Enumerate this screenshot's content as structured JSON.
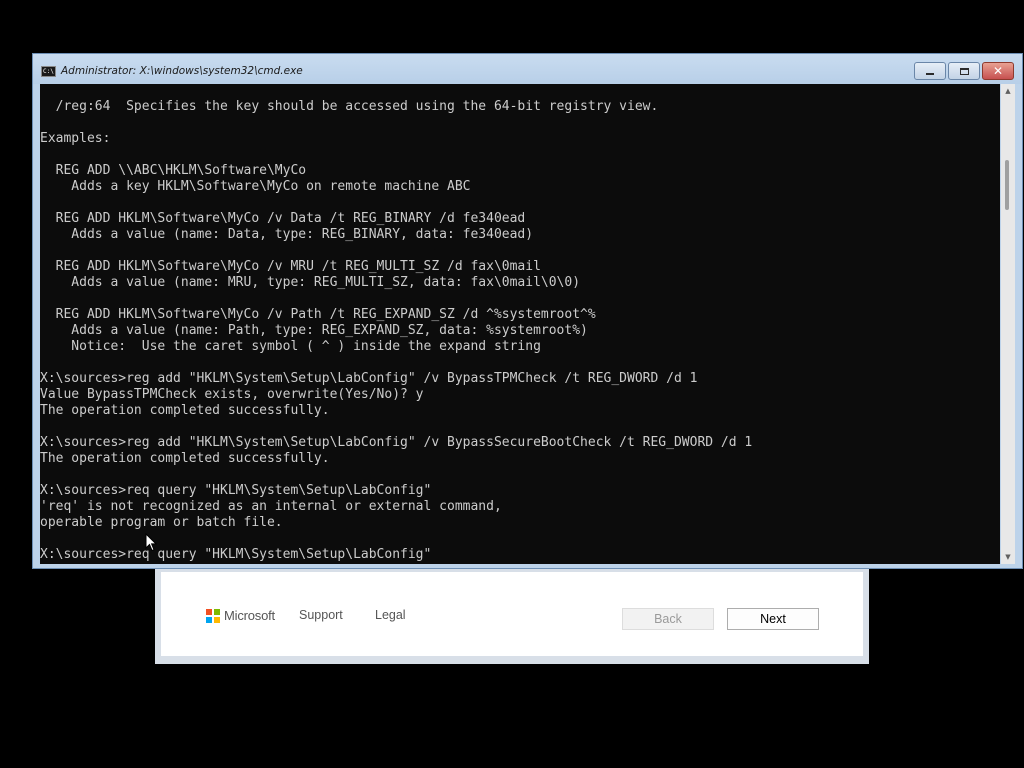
{
  "setup_window": {
    "logo_text": "Microsoft",
    "logo_colors": [
      "#f25022",
      "#7fba00",
      "#00a4ef",
      "#ffb900"
    ],
    "support_label": "Support",
    "legal_label": "Legal",
    "back_label": "Back",
    "next_label": "Next",
    "back_enabled": false
  },
  "cmd_window": {
    "title": "Administrator: X:\\windows\\system32\\cmd.exe",
    "icon": "cmd-icon",
    "icon_text": "C:\\",
    "min_icon": "minimize-icon",
    "max_icon": "maximize-icon",
    "close_icon": "close-icon",
    "close_glyph": "✕",
    "console_lines": [
      "  /reg:64  Specifies the key should be accessed using the 64-bit registry view.",
      "",
      "Examples:",
      "",
      "  REG ADD \\\\ABC\\HKLM\\Software\\MyCo",
      "    Adds a key HKLM\\Software\\MyCo on remote machine ABC",
      "",
      "  REG ADD HKLM\\Software\\MyCo /v Data /t REG_BINARY /d fe340ead",
      "    Adds a value (name: Data, type: REG_BINARY, data: fe340ead)",
      "",
      "  REG ADD HKLM\\Software\\MyCo /v MRU /t REG_MULTI_SZ /d fax\\0mail",
      "    Adds a value (name: MRU, type: REG_MULTI_SZ, data: fax\\0mail\\0\\0)",
      "",
      "  REG ADD HKLM\\Software\\MyCo /v Path /t REG_EXPAND_SZ /d ^%systemroot^%",
      "    Adds a value (name: Path, type: REG_EXPAND_SZ, data: %systemroot%)",
      "    Notice:  Use the caret symbol ( ^ ) inside the expand string",
      "",
      "X:\\sources>reg add \"HKLM\\System\\Setup\\LabConfig\" /v BypassTPMCheck /t REG_DWORD /d 1",
      "Value BypassTPMCheck exists, overwrite(Yes/No)? y",
      "The operation completed successfully.",
      "",
      "X:\\sources>reg add \"HKLM\\System\\Setup\\LabConfig\" /v BypassSecureBootCheck /t REG_DWORD /d 1",
      "The operation completed successfully.",
      "",
      "X:\\sources>req query \"HKLM\\System\\Setup\\LabConfig\"",
      "'req' is not recognized as an internal or external command,",
      "operable program or batch file.",
      "",
      "X:\\sources>req query \"HKLM\\System\\Setup\\LabConfig\""
    ],
    "scroll_up_glyph": "▲",
    "scroll_down_glyph": "▼"
  },
  "cursor": {
    "icon": "mouse-pointer-icon"
  }
}
